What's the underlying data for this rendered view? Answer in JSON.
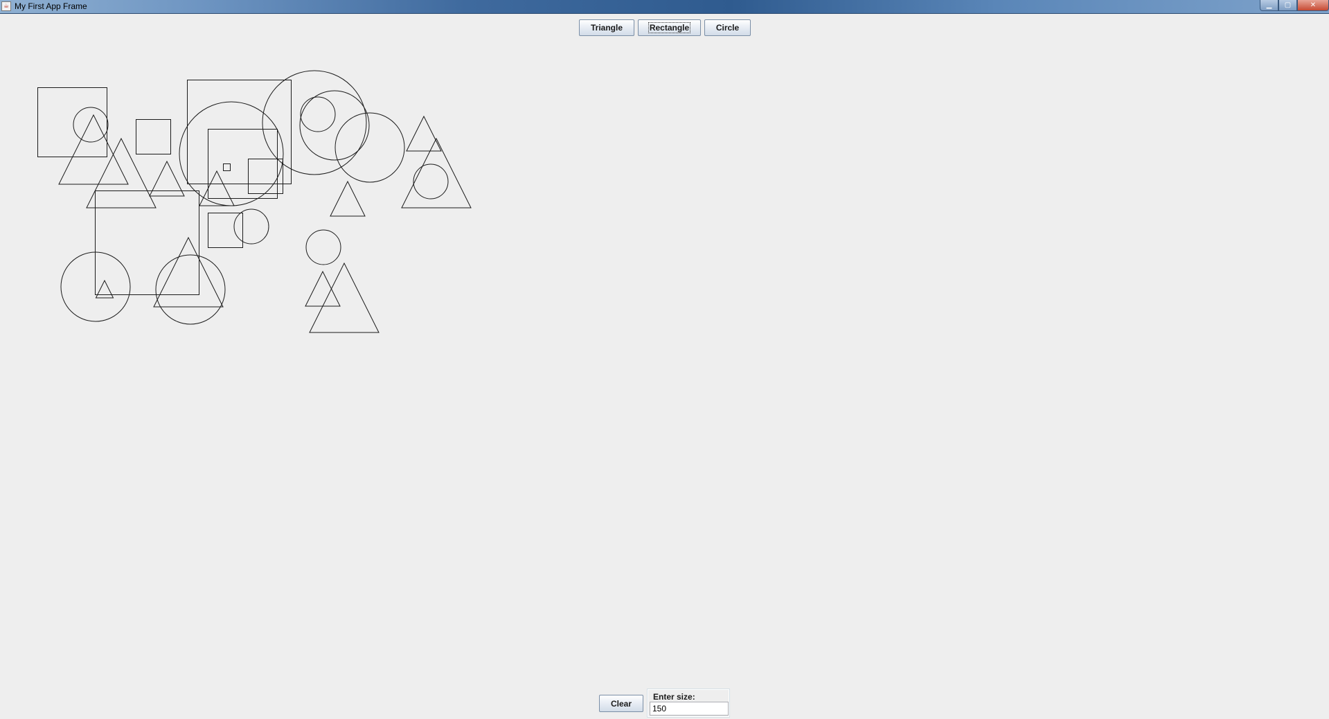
{
  "window": {
    "title": "My First App Frame",
    "controls": {
      "minimize_icon": "minimize-icon",
      "maximize_icon": "maximize-icon",
      "close_icon": "close-icon",
      "minimize_glyph": "▁",
      "maximize_glyph": "▢",
      "close_glyph": "✕"
    }
  },
  "toolbar": {
    "triangle_label": "Triangle",
    "rectangle_label": "Rectangle",
    "circle_label": "Circle"
  },
  "bottom": {
    "clear_label": "Clear",
    "size_legend": "Enter size:",
    "size_value": "150"
  },
  "drawing": {
    "stroke_color": "#1a1a1a",
    "shapes": [
      {
        "type": "rectangle"
      },
      {
        "type": "rectangle"
      },
      {
        "type": "rectangle"
      },
      {
        "type": "rectangle"
      },
      {
        "type": "rectangle"
      },
      {
        "type": "rectangle"
      },
      {
        "type": "rectangle"
      },
      {
        "type": "rectangle"
      },
      {
        "type": "circle"
      },
      {
        "type": "circle"
      },
      {
        "type": "circle"
      },
      {
        "type": "circle"
      },
      {
        "type": "circle"
      },
      {
        "type": "circle"
      },
      {
        "type": "circle"
      },
      {
        "type": "circle"
      },
      {
        "type": "circle"
      },
      {
        "type": "circle"
      },
      {
        "type": "circle"
      },
      {
        "type": "triangle"
      },
      {
        "type": "triangle"
      },
      {
        "type": "triangle"
      },
      {
        "type": "triangle"
      },
      {
        "type": "triangle"
      },
      {
        "type": "triangle"
      },
      {
        "type": "triangle"
      },
      {
        "type": "triangle"
      },
      {
        "type": "triangle"
      },
      {
        "type": "triangle"
      },
      {
        "type": "triangle"
      }
    ]
  }
}
